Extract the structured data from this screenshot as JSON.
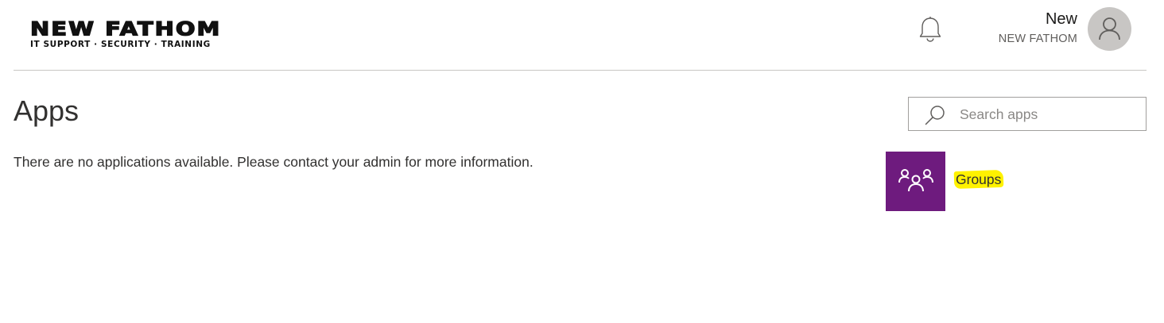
{
  "header": {
    "logo": {
      "main_text": "NEW FATHOM",
      "tagline": "IT SUPPORT · SECURITY · TRAINING"
    },
    "notifications_icon": "bell-icon",
    "user": {
      "name": "New",
      "org": "NEW FATHOM",
      "avatar_icon": "person-icon"
    }
  },
  "main": {
    "title": "Apps",
    "empty_message": "There are no applications available. Please contact your admin for more information."
  },
  "search": {
    "placeholder": "Search apps",
    "value": "",
    "icon": "search-icon"
  },
  "apps": [
    {
      "label": "Groups",
      "icon": "groups-icon",
      "tile_color": "#6e1b7e",
      "highlighted": true,
      "highlight_color": "#fff200"
    }
  ],
  "colors": {
    "divider": "#c8c6c4",
    "avatar_bg": "#c8c6c4",
    "text_primary": "#323130",
    "text_secondary": "#605e5c"
  }
}
